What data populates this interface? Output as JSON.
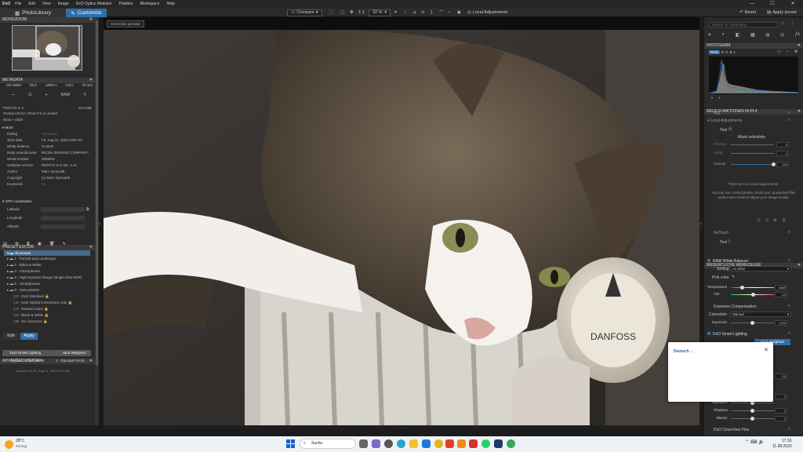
{
  "menubar": {
    "logo": "DxO",
    "items": [
      "File",
      "Edit",
      "View",
      "Image",
      "DxO Optics Modules",
      "Palettes",
      "Workspace",
      "Help"
    ],
    "min": "—",
    "max": "☐",
    "close": "✕"
  },
  "toolbar": {
    "tab_photolibrary": "PhotoLibrary",
    "tab_customize": "Customize",
    "compare": "Compare",
    "zoom_label": "1:1",
    "zoom_value": "32 %",
    "local_adjustments": "Local Adjustments",
    "reset": "Reset",
    "apply_preset": "Apply preset"
  },
  "viewer": {
    "correction_preview": "Correction preview"
  },
  "left": {
    "movezoom_title": "MOVE/ZOOM",
    "metadata_title": "METADATA",
    "exif": [
      "ISO 5000",
      "f/5.6",
      "1/800 s",
      "0 EV",
      "70 mm"
    ],
    "format": "RAW",
    "camera": "PENTAX K-3",
    "lens": "Pentax HD DA 70mm F2.4 Limited",
    "dimensions": "6016 × 4000",
    "filesize": "32,9 MB",
    "more_label": "More",
    "meta_rows": [
      {
        "k": "Rating",
        "v": "☆☆☆☆☆"
      },
      {
        "k": "Shot date",
        "v": "Fri, Aug 11, 2023 9:09 AM"
      },
      {
        "k": "White balance",
        "v": "Custom"
      },
      {
        "k": "Body manufacturer",
        "v": "RICOH IMAGING COMPANY..."
      },
      {
        "k": "Serial number",
        "v": "4956811"
      },
      {
        "k": "Software version",
        "v": "PENTAX K-3 Ver. 1.43"
      },
      {
        "k": "Author",
        "v": "Marc Synwoldt"
      },
      {
        "k": "Copyright",
        "v": "(c) Marc Synwoldt"
      },
      {
        "k": "Keywords",
        "v": "—"
      }
    ],
    "gps_label": "GPS coordinates",
    "gps_rows": [
      "Latitude",
      "Longitude",
      "Altitude"
    ],
    "preset_title": "PRESET EDITOR",
    "presets": [
      "All presets",
      "1 - Portrait and Landscape",
      "2 - Black & White",
      "3 - Atmospheres",
      "4 - High Dynamic Range (single-shot HDR)",
      "5 - Smartphones",
      "9 - Own presets",
      "1 - DxO Standard",
      "2 - DxO Optical Corrections only",
      "3 - Neutral colors",
      "4 - Black & White",
      "5 - No correction"
    ],
    "edit_label": "Edit",
    "apply_label": "Apply",
    "history_title": "ADVANCED HISTORY",
    "history": [
      {
        "a": "DxO Smart Lighting",
        "b": "Spot Weighted"
      },
      {
        "a": "Applied default preset",
        "b": "1 - Standard Work..."
      }
    ],
    "imported": "Imported on Fri, Aug 11, 2023 9:18 AM"
  },
  "right": {
    "search_placeholder": "Search for corrections...",
    "histogram_title": "HISTOGRAM",
    "hist_channels": [
      "RGB",
      "R",
      "G",
      "B",
      "L"
    ],
    "newpl4_title": "NEUE FUNKTIONEN IN PL4",
    "hsl": "HSL",
    "local_adj": "Local Adjustments",
    "tool_label": "Tool",
    "mask_sel": "Mask selectivity",
    "chroma": "Chroma",
    "luma": "Luma",
    "opacity": "Opacity",
    "opacity_val": "100",
    "zero": "0",
    "no_local": "There are no Local Adjustments.",
    "no_local_hint": "You can use control points, brush tool, graduated filter and/or auto mask to adjust your image locally.",
    "reflect": "ReTouch",
    "wesentliche_title": "WESENTLICHE WERKZEUGE",
    "raw_wb": "RAW White Balance",
    "setting": "Setting",
    "as_shot": "As Shot",
    "pick_color": "Pick color",
    "temperature": "Temperature",
    "temp_val": "4669",
    "tint": "Tint",
    "tint_val": "-10",
    "exposure_comp": "Exposure Compensation",
    "correction": "Correction",
    "manual": "Manual",
    "exposure": "Exposure",
    "exposure_val": "0,00",
    "smart_lighting": "DxO Smart Lighting",
    "spot_weighted": "Spot Weighted",
    "highlights": "Highlights",
    "shadows": "Shadows",
    "blacks": "Blacks",
    "clearview": "DxO ClearView Plus",
    "sv_25": "25",
    "sv_0": "0"
  },
  "popup": {
    "language": "Deutsch",
    "chevron": "⌄",
    "close": "✕"
  },
  "taskbar": {
    "temp": "28°C",
    "weather": "Sonnig",
    "search": "Suche",
    "time": "17:16",
    "date": "11.08.2023"
  },
  "colors": {
    "accent": "#2f6fa8",
    "panel": "#2a2a2a",
    "header": "#3a3a3a"
  }
}
